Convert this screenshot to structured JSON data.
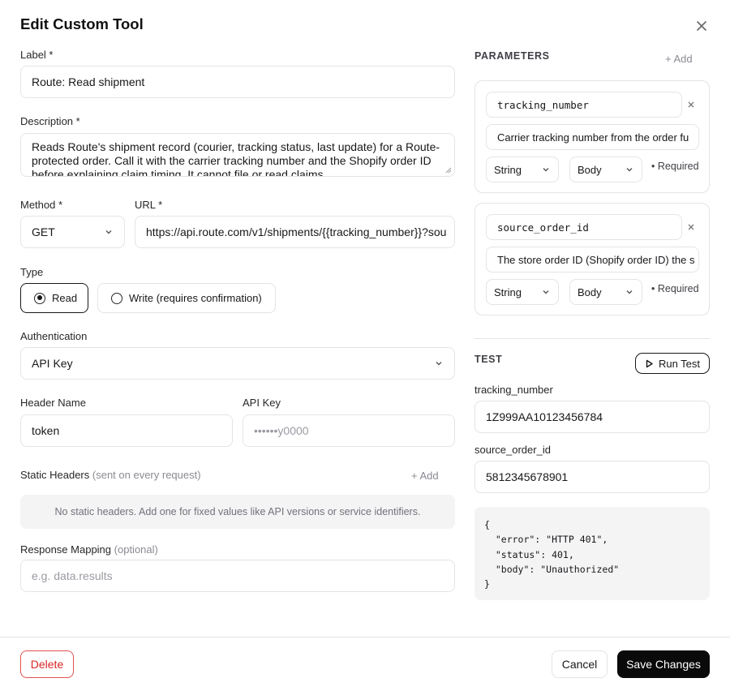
{
  "title": "Edit Custom Tool",
  "label_field": {
    "label": "Label *",
    "value": "Route: Read shipment"
  },
  "description_field": {
    "label": "Description *",
    "value": "Reads Route's shipment record (courier, tracking status, last update) for a Route-protected order. Call it with the carrier tracking number and the Shopify order ID before explaining claim timing. It cannot file or read claims."
  },
  "method_field": {
    "label": "Method *",
    "value": "GET"
  },
  "url_field": {
    "label": "URL *",
    "value": "https://api.route.com/v1/shipments/{{tracking_number}}?sou"
  },
  "type_field": {
    "label": "Type",
    "options": [
      {
        "label": "Read",
        "selected": true
      },
      {
        "label": "Write (requires confirmation)",
        "selected": false
      }
    ]
  },
  "auth_field": {
    "label": "Authentication",
    "value": "API Key"
  },
  "header_name_field": {
    "label": "Header Name",
    "value": "token"
  },
  "api_key_field": {
    "label": "API Key",
    "placeholder": "••••••y0000"
  },
  "static_headers": {
    "label": "Static Headers",
    "hint": "(sent on every request)",
    "add_label": "+ Add",
    "empty_text": "No static headers. Add one for fixed values like API versions or service identifiers."
  },
  "response_mapping": {
    "label": "Response Mapping",
    "hint": "(optional)",
    "placeholder": "e.g. data.results"
  },
  "parameters": {
    "title": "PARAMETERS",
    "add_label": "+ Add",
    "items": [
      {
        "name": "tracking_number",
        "description": "Carrier tracking number from the order fu",
        "type": "String",
        "location": "Body",
        "required_label": "• Required"
      },
      {
        "name": "source_order_id",
        "description": "The store order ID (Shopify order ID) the s",
        "type": "String",
        "location": "Body",
        "required_label": "• Required"
      }
    ]
  },
  "test": {
    "title": "TEST",
    "run_label": "Run Test",
    "inputs": [
      {
        "label": "tracking_number",
        "value": "1Z999AA10123456784"
      },
      {
        "label": "source_order_id",
        "value": "5812345678901"
      }
    ],
    "result": "{\n  \"error\": \"HTTP 401\",\n  \"status\": 401,\n  \"body\": \"Unauthorized\"\n}"
  },
  "footer": {
    "delete_label": "Delete",
    "cancel_label": "Cancel",
    "save_label": "Save Changes"
  },
  "colors": {
    "primary": "#0a0a0a",
    "danger": "#dc2626",
    "border": "#e4e4e7",
    "muted_bg": "#f4f4f5"
  }
}
